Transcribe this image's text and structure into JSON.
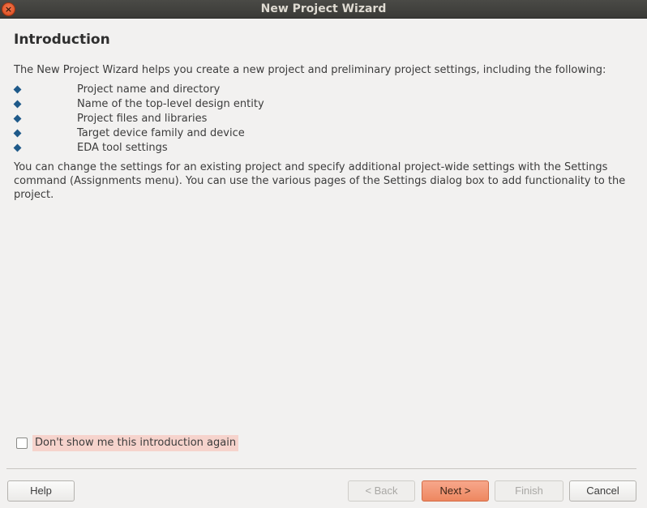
{
  "window": {
    "title": "New Project Wizard",
    "close_glyph": "×"
  },
  "page": {
    "heading": "Introduction",
    "intro": "The New Project Wizard helps you create a new project and preliminary project settings, including the following:",
    "items": [
      {
        "label": "Project name and directory"
      },
      {
        "label": "Name of the top-level design entity"
      },
      {
        "label": "Project files and libraries"
      },
      {
        "label": "Target device family and device"
      },
      {
        "label": "EDA tool settings"
      }
    ],
    "more": "You can change the settings for an existing project and specify additional project-wide settings with the Settings command (Assignments menu). You can use the various pages of the Settings dialog box to add functionality to the project."
  },
  "checkbox": {
    "label": "Don't show me this introduction again",
    "checked": false
  },
  "buttons": {
    "help": "Help",
    "back": "< Back",
    "next": "Next >",
    "finish": "Finish",
    "cancel": "Cancel"
  },
  "colors": {
    "accent": "#ee8760",
    "bullet": "#1f5a8a",
    "highlight": "#f6d3cc"
  }
}
